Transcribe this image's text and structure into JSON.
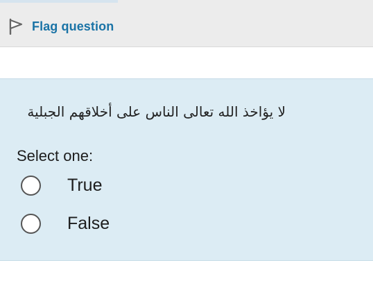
{
  "flag": {
    "label": "Flag question",
    "icon": "flag-outline-icon"
  },
  "question": {
    "text": "لا يؤاخذ الله تعالى الناس على أخلاقهم الجبلية",
    "prompt": "Select one:",
    "options": [
      {
        "label": "True",
        "selected": false
      },
      {
        "label": "False",
        "selected": false
      }
    ]
  },
  "colors": {
    "question_background": "#dcecf4",
    "link": "#1a73a6",
    "header_background": "#ececec"
  }
}
